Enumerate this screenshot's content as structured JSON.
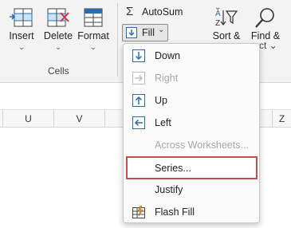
{
  "ribbon": {
    "insert": {
      "label": "Insert",
      "chev": "⌄"
    },
    "delete": {
      "label": "Delete",
      "chev": "⌄"
    },
    "format": {
      "label": "Format",
      "chev": "⌄"
    },
    "cells_group_label": "Cells",
    "autosum": {
      "label": "AutoSum",
      "symbol": "Σ",
      "chev": "⌄"
    },
    "fill": {
      "label": "Fill",
      "chev": "⌄"
    },
    "sort": {
      "label": "Sort &",
      "chev": "⌄"
    },
    "find": {
      "label": "Find &",
      "sub": "ect ⌄"
    }
  },
  "columns": [
    "U",
    "V",
    "Z"
  ],
  "fill_menu": {
    "items": [
      {
        "label": "Down",
        "enabled": true,
        "icon": "fill-down-icon"
      },
      {
        "label": "Right",
        "enabled": false,
        "icon": "fill-right-icon"
      },
      {
        "label": "Up",
        "enabled": true,
        "icon": "fill-up-icon"
      },
      {
        "label": "Left",
        "enabled": true,
        "icon": "fill-left-icon"
      },
      {
        "label": "Across Worksheets...",
        "enabled": false,
        "icon": ""
      },
      {
        "label": "Series...",
        "enabled": true,
        "icon": "",
        "highlighted": true
      },
      {
        "label": "Justify",
        "enabled": true,
        "icon": ""
      },
      {
        "label": "Flash Fill",
        "enabled": true,
        "icon": "flash-fill-icon"
      }
    ]
  },
  "colors": {
    "accent_blue": "#2b6cb0",
    "highlight_border": "#c0504d",
    "delete_red": "#d13438"
  }
}
